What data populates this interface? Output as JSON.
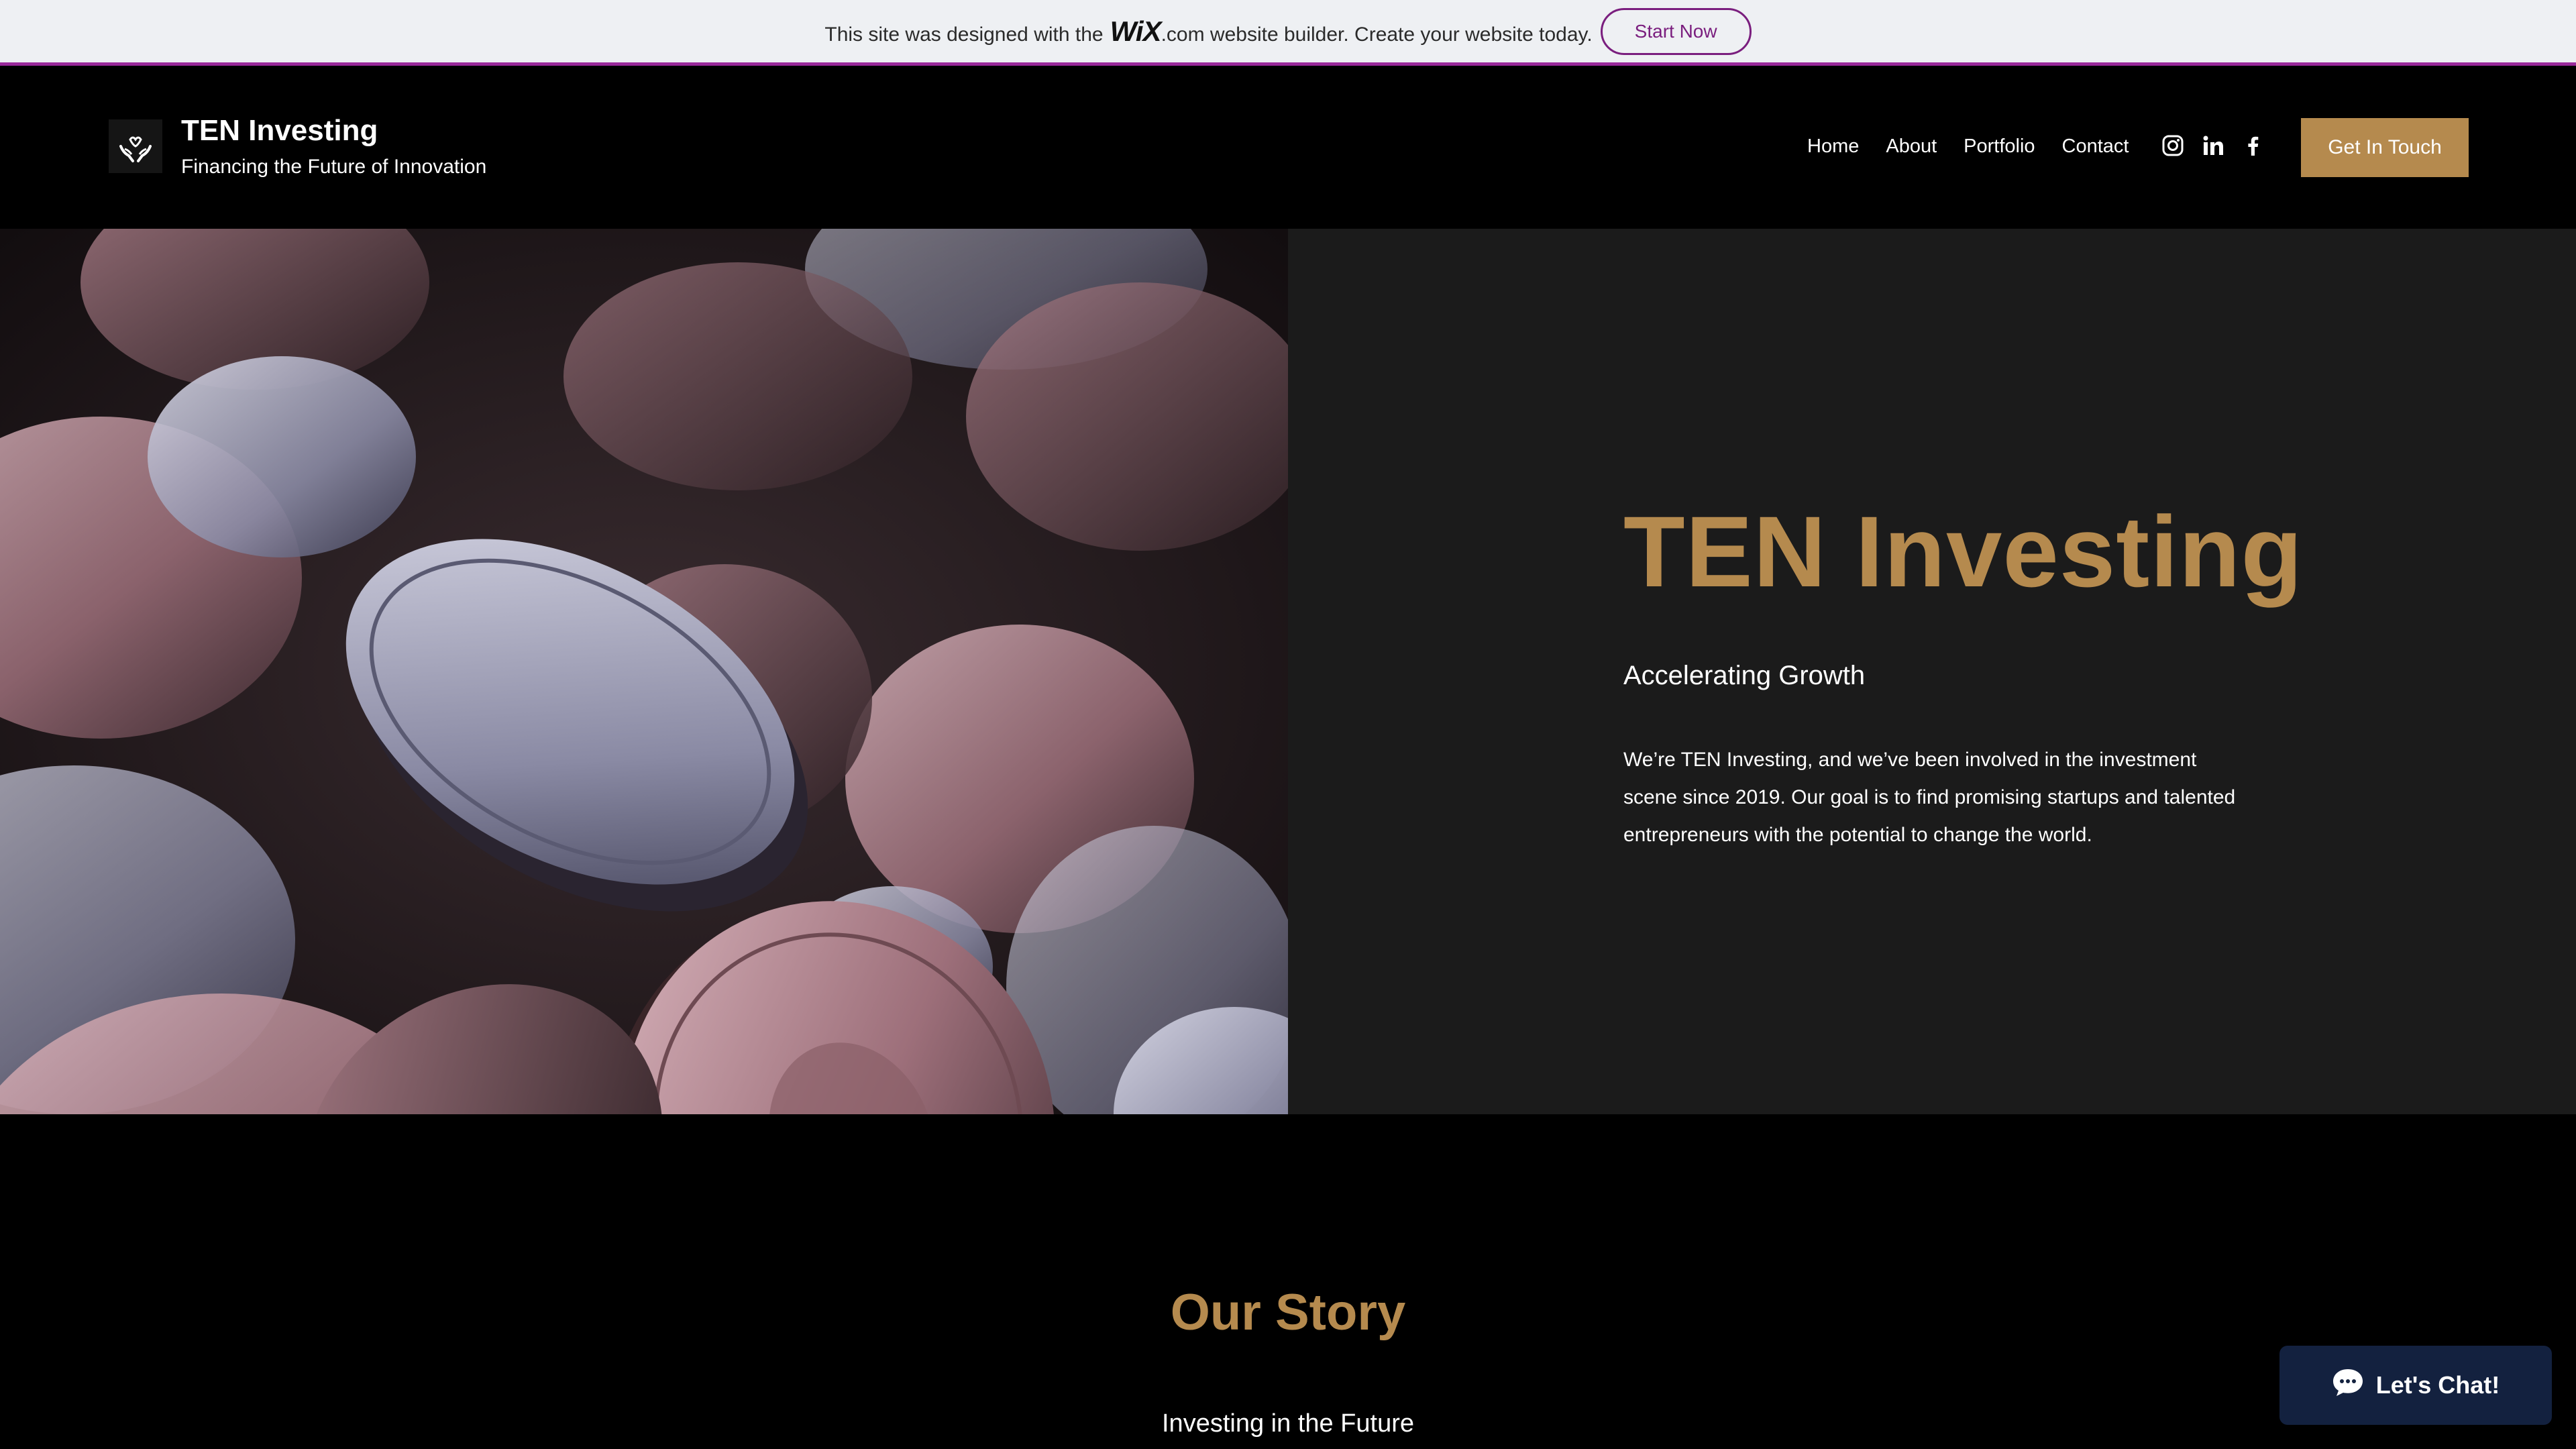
{
  "wix_banner": {
    "text_before": "This site was designed with the",
    "logo": "WiX",
    "text_after": ".com website builder. Create your website today.",
    "button": "Start Now"
  },
  "header": {
    "brand_title": "TEN Investing",
    "brand_tagline": "Financing the Future of Innovation",
    "logo_icon": "hands-holding-heart-icon",
    "nav": [
      "Home",
      "About",
      "Portfolio",
      "Contact"
    ],
    "social": [
      "instagram-icon",
      "linkedin-icon",
      "facebook-icon"
    ],
    "cta": "Get In Touch"
  },
  "hero": {
    "title": "TEN Investing",
    "subtitle": "Accelerating Growth",
    "body": "We’re TEN Investing, and we’ve been involved in the investment scene since 2019. Our goal is to find promising startups and talented entrepreneurs with the potential to change the world."
  },
  "story": {
    "title": "Our Story",
    "subtitle": "Investing in the Future"
  },
  "chat": {
    "label": "Let's Chat!"
  },
  "colors": {
    "accent": "#b58a4e",
    "banner_bg": "#eef0f3",
    "banner_border": "#9a2a9b",
    "panel_bg": "#1b1b1b",
    "chat_bg": "#13213f"
  }
}
